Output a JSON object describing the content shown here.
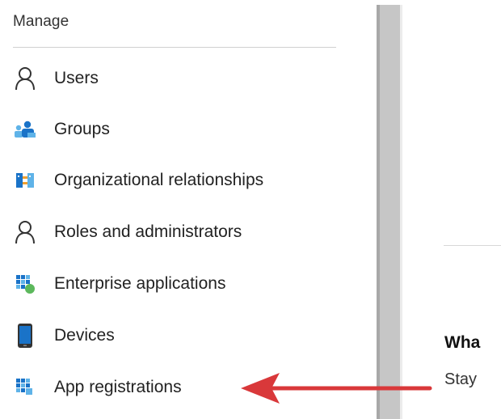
{
  "sidebar": {
    "section_title": "Manage",
    "items": [
      {
        "label": "Users",
        "icon": "user-outline-icon"
      },
      {
        "label": "Groups",
        "icon": "groups-icon"
      },
      {
        "label": "Organizational relationships",
        "icon": "organizational-relationships-icon"
      },
      {
        "label": "Roles and administrators",
        "icon": "user-outline-icon"
      },
      {
        "label": "Enterprise applications",
        "icon": "enterprise-apps-icon"
      },
      {
        "label": "Devices",
        "icon": "device-icon"
      },
      {
        "label": "App registrations",
        "icon": "app-registrations-icon"
      }
    ]
  },
  "content": {
    "heading_partial": "Wha",
    "text_partial": "Stay"
  },
  "annotation": {
    "arrow_color": "#d9383a"
  },
  "colors": {
    "icon_blue": "#1a73c8",
    "icon_light_blue": "#5fb3e8",
    "icon_green": "#5cb85c",
    "icon_orange": "#f0a030"
  }
}
